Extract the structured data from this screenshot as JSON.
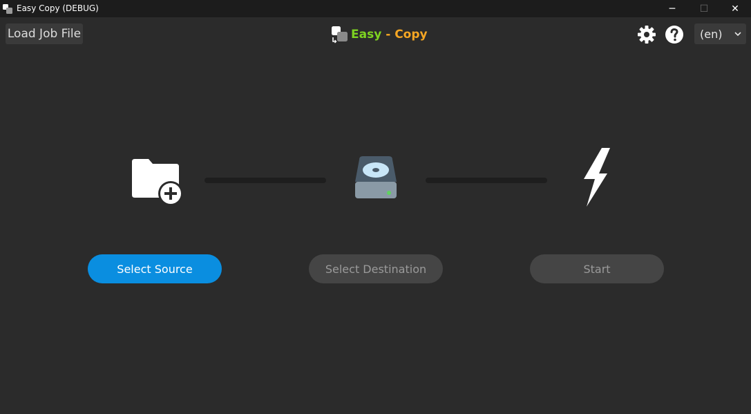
{
  "window": {
    "title": "Easy Copy (DEBUG)",
    "minimize_glyph": "─",
    "maximize_glyph": "☐",
    "close_glyph": "✕"
  },
  "header": {
    "load_job_label": "Load Job File",
    "brand": {
      "easy": "Easy",
      "separator": " - ",
      "copy": "Copy"
    },
    "language": "(en)",
    "icons": [
      "gear-icon",
      "help-icon",
      "chevron-down-icon"
    ]
  },
  "steps": [
    {
      "icon": "folder-add-icon",
      "label": "Select Source",
      "state": "active"
    },
    {
      "icon": "hard-drive-icon",
      "label": "Select Destination",
      "state": "disabled"
    },
    {
      "icon": "lightning-icon",
      "label": "Start",
      "state": "disabled"
    }
  ],
  "colors": {
    "accent": "#0a8ee0",
    "brand_easy": "#7ed321",
    "brand_copy": "#f5a623",
    "background": "#2b2b2b",
    "titlebar": "#1c1c1c",
    "disabled_button": "#454545",
    "drive_led": "#5fd35f"
  }
}
